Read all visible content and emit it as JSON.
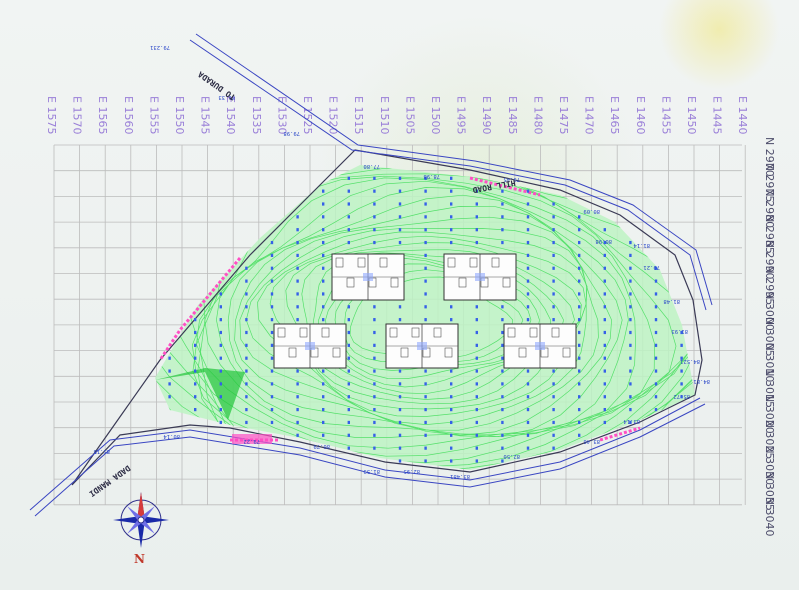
{
  "map": {
    "easting_labels": [
      "E 1575",
      "E 1570",
      "E 1565",
      "E 1560",
      "E 1555",
      "E 1550",
      "E 1545",
      "E 1540",
      "E 1535",
      "E 1530",
      "E 1525",
      "E 1520",
      "E 1515",
      "E 1510",
      "E 1505",
      "E 1500",
      "E 1495",
      "E 1490",
      "E 1485",
      "E 1480",
      "E 1475",
      "E 1470",
      "E 1465",
      "E 1460",
      "E 1455",
      "E 1450",
      "E 1445",
      "E 1440"
    ],
    "northing_labels": [
      "N 2970",
      "N 2975",
      "N 2980",
      "N 2985",
      "N 2990",
      "N 2995",
      "N 3000",
      "N 3005",
      "N 3010",
      "N 3015",
      "N 3020",
      "N 3025",
      "N 3030",
      "N 3035",
      "N 3040"
    ],
    "road_labels": {
      "top_left": "TO DURADA",
      "top_right": "HILL ROAD",
      "bottom_left": "DADA MANDI"
    },
    "spot_levels": [
      "79.231",
      "79.98",
      "77.80",
      "78.98",
      "79.45",
      "80.09",
      "81.14",
      "81.48",
      "81.93",
      "84.521",
      "84.81",
      "85.72",
      "83.14",
      "83.46",
      "82.50",
      "83.481",
      "82.95",
      "81.59",
      "80.79",
      "79.22",
      "80.14",
      "85.15",
      "81.33",
      "80.98",
      "79.21"
    ],
    "compass": {
      "north_label": "N"
    },
    "colors": {
      "grid": "#bcbcbc",
      "contours": "#54e06a",
      "contour_fill": "#bdf3c3",
      "boundary": "#3a3a55",
      "road": "#3a46c2",
      "accent_pink": "#ff4fc4",
      "dots": "#3560e8",
      "labels": "#9a7fd8"
    }
  }
}
